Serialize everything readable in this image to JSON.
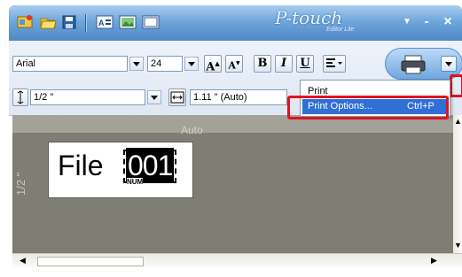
{
  "colors": {
    "highlight": "#e0131c",
    "menu_selected": "#2f6fd6",
    "canvas": "#7f7e74"
  },
  "title_bar": {
    "brand_logo": "P-touch",
    "brand_edition": "Editor Lite",
    "quick_access_icons": [
      "new-label-icon",
      "open-folder-icon",
      "save-icon",
      "text-icon",
      "image-icon",
      "frame-icon"
    ],
    "minimize_glyph": "-",
    "close_glyph": "×"
  },
  "toolbar": {
    "font_family": "Arial",
    "font_size": "24",
    "grow_font_label": "A",
    "shrink_font_label": "A",
    "bold_label": "B",
    "italic_label": "I",
    "underline_label": "U",
    "tape_width": "1/2 \"",
    "label_length": "1.11 \" (Auto)"
  },
  "menu": {
    "items": [
      {
        "label": "Print",
        "shortcut": ""
      },
      {
        "label": "Print Options...",
        "shortcut": "Ctrl+P"
      }
    ],
    "selected_index": 1
  },
  "canvas": {
    "tape_label": "1/2 \"",
    "label_text": "File ",
    "number_value": "001",
    "number_tag": "NUM",
    "length_mode": "Auto"
  }
}
